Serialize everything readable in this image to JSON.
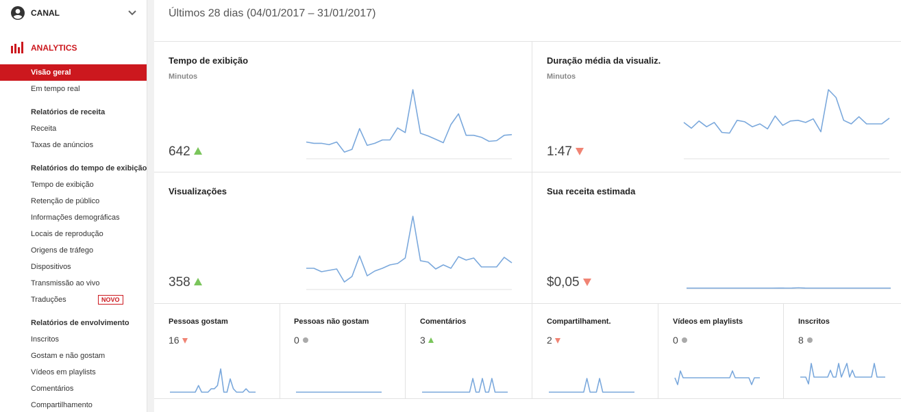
{
  "sidebar": {
    "channel_label": "CANAL",
    "analytics_label": "ANALYTICS",
    "nav": [
      {
        "kind": "item",
        "label": "Visão geral",
        "active": true
      },
      {
        "kind": "item",
        "label": "Em tempo real"
      },
      {
        "kind": "group",
        "label": "Relatórios de receita"
      },
      {
        "kind": "item",
        "label": "Receita"
      },
      {
        "kind": "item",
        "label": "Taxas de anúncios"
      },
      {
        "kind": "group",
        "label": "Relatórios do tempo de exibição"
      },
      {
        "kind": "item",
        "label": "Tempo de exibição"
      },
      {
        "kind": "item",
        "label": "Retenção de público"
      },
      {
        "kind": "item",
        "label": "Informações demográficas"
      },
      {
        "kind": "item",
        "label": "Locais de reprodução"
      },
      {
        "kind": "item",
        "label": "Origens de tráfego"
      },
      {
        "kind": "item",
        "label": "Dispositivos"
      },
      {
        "kind": "item",
        "label": "Transmissão ao vivo"
      },
      {
        "kind": "item",
        "label": "Traduções",
        "badge": "NOVO"
      },
      {
        "kind": "group",
        "label": "Relatórios de envolvimento"
      },
      {
        "kind": "item",
        "label": "Inscritos"
      },
      {
        "kind": "item",
        "label": "Gostam e não gostam"
      },
      {
        "kind": "item",
        "label": "Vídeos em playlists"
      },
      {
        "kind": "item",
        "label": "Comentários"
      },
      {
        "kind": "item",
        "label": "Compartilhamento"
      }
    ]
  },
  "main": {
    "period": "Últimos 28 dias (04/01/2017 – 31/01/2017)",
    "cards": {
      "watch_time": {
        "title": "Tempo de exibição",
        "unit": "Minutos",
        "value": "642",
        "trend": "up",
        "series": [
          24,
          22,
          22,
          20,
          24,
          9,
          13,
          44,
          19,
          22,
          27,
          27,
          45,
          38,
          102,
          37,
          33,
          28,
          23,
          50,
          66,
          34,
          34,
          31,
          25,
          26,
          34,
          35
        ]
      },
      "avg_duration": {
        "title": "Duração média da visualiz.",
        "unit": "Minutos",
        "value": "1:47",
        "trend": "down",
        "series": [
          50,
          42,
          52,
          44,
          50,
          36,
          35,
          53,
          51,
          44,
          48,
          41,
          59,
          46,
          52,
          53,
          50,
          55,
          37,
          96,
          85,
          53,
          48,
          58,
          48,
          48,
          48,
          56
        ]
      },
      "views": {
        "title": "Visualizações",
        "value": "358",
        "trend": "up",
        "series": [
          30,
          30,
          25,
          27,
          29,
          10,
          18,
          48,
          19,
          26,
          30,
          35,
          37,
          45,
          106,
          41,
          39,
          29,
          35,
          30,
          47,
          42,
          45,
          32,
          32,
          32,
          46,
          38
        ]
      },
      "revenue": {
        "title": "Sua receita estimada",
        "value": "$0,05",
        "trend": "down",
        "series": [
          0,
          0,
          0,
          0,
          0,
          0,
          0,
          0,
          0,
          0,
          0,
          0,
          0,
          0,
          0.2,
          0.1,
          0.3,
          1.4,
          0.2,
          0.1,
          0,
          0,
          0,
          0,
          0,
          0,
          0,
          0,
          0,
          0,
          0,
          0
        ]
      }
    },
    "small_cards": [
      {
        "title": "Pessoas gostam",
        "value": "16",
        "trend": "down",
        "series": [
          0,
          0,
          0,
          0,
          0,
          0,
          0,
          0,
          0,
          2,
          0,
          0,
          0,
          1,
          1,
          2,
          7,
          0,
          0,
          4,
          1,
          0,
          0,
          0,
          1,
          0,
          0,
          0
        ]
      },
      {
        "title": "Pessoas não gostam",
        "value": "0",
        "trend": "flat",
        "series": [
          0,
          0,
          0,
          0,
          0,
          0,
          0,
          0,
          0,
          0,
          0,
          0,
          0,
          0,
          0,
          0,
          0,
          0,
          0,
          0,
          0,
          0,
          0,
          0,
          0,
          0,
          0,
          0
        ]
      },
      {
        "title": "Comentários",
        "value": "3",
        "trend": "up",
        "series": [
          0,
          0,
          0,
          0,
          0,
          0,
          0,
          0,
          0,
          0,
          0,
          0,
          0,
          0,
          0,
          0,
          1,
          0,
          0,
          1,
          0,
          0,
          1,
          0,
          0,
          0,
          0,
          0
        ]
      },
      {
        "title": "Compartilhament.",
        "value": "2",
        "trend": "down",
        "series": [
          0,
          0,
          0,
          0,
          0,
          0,
          0,
          0,
          0,
          0,
          0,
          0,
          1,
          0,
          0,
          0,
          1,
          0,
          0,
          0,
          0,
          0,
          0,
          0,
          0,
          0,
          0,
          0
        ]
      },
      {
        "title": "Vídeos em playlists",
        "value": "0",
        "trend": "flat",
        "series": [
          1,
          0,
          2,
          1,
          1,
          1,
          1,
          1,
          1,
          1,
          1,
          1,
          1,
          1,
          1,
          1,
          1,
          1,
          1,
          1,
          1,
          2,
          1,
          1,
          1,
          1,
          1,
          1,
          0,
          1,
          1,
          1
        ]
      },
      {
        "title": "Inscritos",
        "value": "8",
        "trend": "flat",
        "series": [
          1,
          1,
          1,
          0,
          3,
          1,
          1,
          1,
          1,
          1,
          1,
          2,
          1,
          1,
          3,
          1,
          2,
          3,
          1,
          2,
          1,
          1,
          1,
          1,
          1,
          1,
          1,
          3,
          1,
          1,
          1,
          1
        ]
      }
    ]
  }
}
